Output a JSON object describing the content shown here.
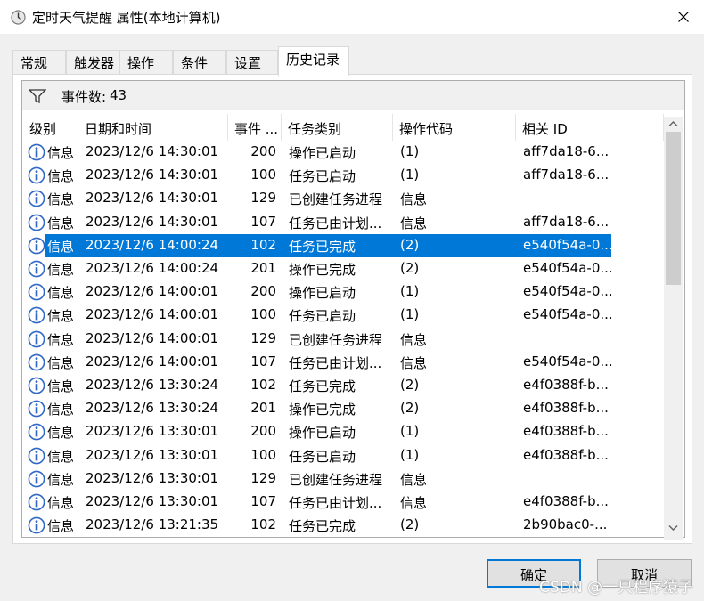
{
  "window": {
    "title": "定时天气提醒 属性(本地计算机)"
  },
  "tabs": [
    "常规",
    "触发器",
    "操作",
    "条件",
    "设置",
    "历史记录"
  ],
  "filter": {
    "label": "事件数:",
    "count": "43"
  },
  "columns": [
    "级别",
    "日期和时间",
    "事件 ...",
    "任务类别",
    "操作代码",
    "相关 ID"
  ],
  "rows": [
    {
      "level": "信息",
      "datetime": "2023/12/6 14:30:01",
      "event": "200",
      "category": "操作已启动",
      "opcode": "(1)",
      "id": "aff7da18-6..."
    },
    {
      "level": "信息",
      "datetime": "2023/12/6 14:30:01",
      "event": "100",
      "category": "任务已启动",
      "opcode": "(1)",
      "id": "aff7da18-6..."
    },
    {
      "level": "信息",
      "datetime": "2023/12/6 14:30:01",
      "event": "129",
      "category": "已创建任务进程",
      "opcode": "信息",
      "id": ""
    },
    {
      "level": "信息",
      "datetime": "2023/12/6 14:30:01",
      "event": "107",
      "category": "任务已由计划...",
      "opcode": "信息",
      "id": "aff7da18-6..."
    },
    {
      "level": "信息",
      "datetime": "2023/12/6 14:00:24",
      "event": "102",
      "category": "任务已完成",
      "opcode": "(2)",
      "id": "e540f54a-0...",
      "selected": true
    },
    {
      "level": "信息",
      "datetime": "2023/12/6 14:00:24",
      "event": "201",
      "category": "操作已完成",
      "opcode": "(2)",
      "id": "e540f54a-0..."
    },
    {
      "level": "信息",
      "datetime": "2023/12/6 14:00:01",
      "event": "200",
      "category": "操作已启动",
      "opcode": "(1)",
      "id": "e540f54a-0..."
    },
    {
      "level": "信息",
      "datetime": "2023/12/6 14:00:01",
      "event": "100",
      "category": "任务已启动",
      "opcode": "(1)",
      "id": "e540f54a-0..."
    },
    {
      "level": "信息",
      "datetime": "2023/12/6 14:00:01",
      "event": "129",
      "category": "已创建任务进程",
      "opcode": "信息",
      "id": ""
    },
    {
      "level": "信息",
      "datetime": "2023/12/6 14:00:01",
      "event": "107",
      "category": "任务已由计划...",
      "opcode": "信息",
      "id": "e540f54a-0..."
    },
    {
      "level": "信息",
      "datetime": "2023/12/6 13:30:24",
      "event": "102",
      "category": "任务已完成",
      "opcode": "(2)",
      "id": "e4f0388f-b..."
    },
    {
      "level": "信息",
      "datetime": "2023/12/6 13:30:24",
      "event": "201",
      "category": "操作已完成",
      "opcode": "(2)",
      "id": "e4f0388f-b..."
    },
    {
      "level": "信息",
      "datetime": "2023/12/6 13:30:01",
      "event": "200",
      "category": "操作已启动",
      "opcode": "(1)",
      "id": "e4f0388f-b..."
    },
    {
      "level": "信息",
      "datetime": "2023/12/6 13:30:01",
      "event": "100",
      "category": "任务已启动",
      "opcode": "(1)",
      "id": "e4f0388f-b..."
    },
    {
      "level": "信息",
      "datetime": "2023/12/6 13:30:01",
      "event": "129",
      "category": "已创建任务进程",
      "opcode": "信息",
      "id": ""
    },
    {
      "level": "信息",
      "datetime": "2023/12/6 13:30:01",
      "event": "107",
      "category": "任务已由计划...",
      "opcode": "信息",
      "id": "e4f0388f-b..."
    },
    {
      "level": "信息",
      "datetime": "2023/12/6 13:21:35",
      "event": "102",
      "category": "任务已完成",
      "opcode": "(2)",
      "id": "2b90bac0-..."
    }
  ],
  "buttons": {
    "ok": "确定",
    "cancel": "取消"
  },
  "watermark": "CSDN @一只程序猿子",
  "colors": {
    "selection": "#0078d7",
    "info_icon": "#3168c5"
  },
  "icons": {
    "title": "clock-icon",
    "filter": "filter-icon",
    "level": "info-icon",
    "close": "close-icon"
  }
}
